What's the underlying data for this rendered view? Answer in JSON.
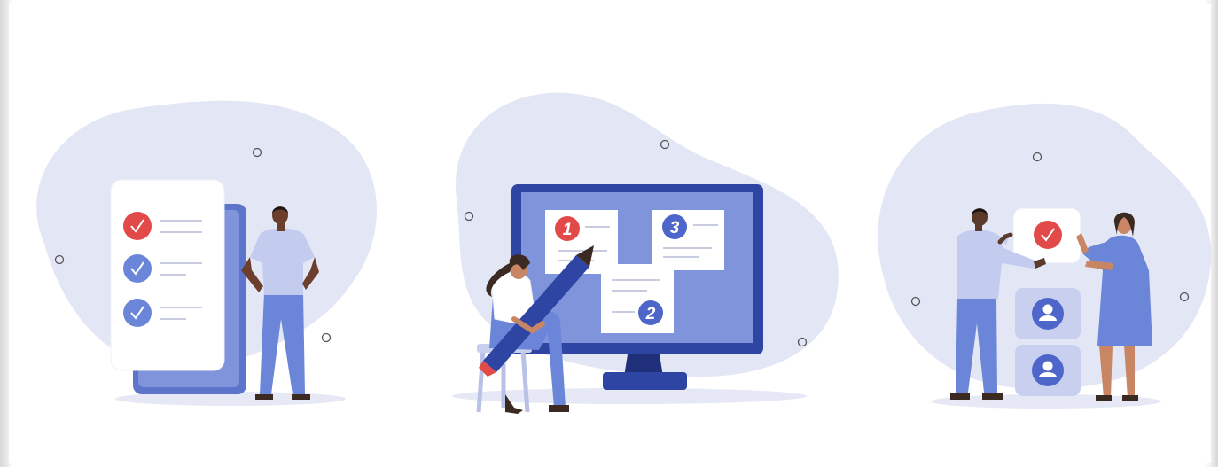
{
  "scenes": [
    {
      "name": "checklist-scene",
      "checks": 3
    },
    {
      "name": "monitor-notes-scene",
      "notes": [
        "1",
        "3",
        "2"
      ]
    },
    {
      "name": "team-selection-scene",
      "profiles": 2
    }
  ],
  "colors": {
    "blob": "#e3e7f5",
    "accent_red": "#e24a4a",
    "accent_blue": "#6b86d9",
    "navy": "#2f45a3",
    "skin_dark": "#5a3a2a",
    "skin_tan": "#c98664"
  },
  "icons": [
    "check-icon",
    "pencil-icon",
    "user-icon"
  ]
}
